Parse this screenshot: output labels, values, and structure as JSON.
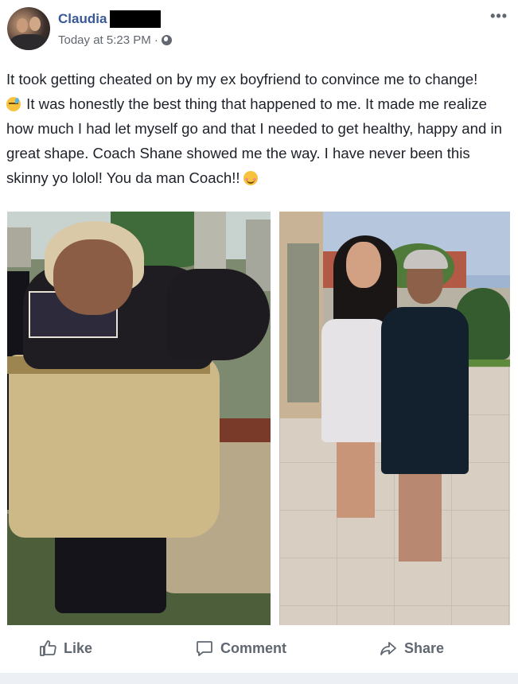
{
  "post": {
    "author": "Claudia",
    "timestamp": "Today at 5:23 PM ·",
    "text": {
      "part1": "It took getting cheated on by my ex boyfriend to convince me to change!",
      "part2": " It was honestly the best thing that happened to me. It made me realize how much I had let myself go and that I needed to get healthy, happy and in great shape. Coach Shane showed me the way. I have never been this skinny yo lolol! You da man Coach!!"
    },
    "emoji": [
      "sweat-emoji",
      "smiling-face-emoji"
    ],
    "privacy_icon": "globe-icon",
    "menu_icon": "ellipsis-icon"
  },
  "actions": {
    "like": "Like",
    "comment": "Comment",
    "share": "Share"
  },
  "colors": {
    "author_link": "#385898",
    "meta_text": "#616770",
    "action_text": "#606770"
  }
}
